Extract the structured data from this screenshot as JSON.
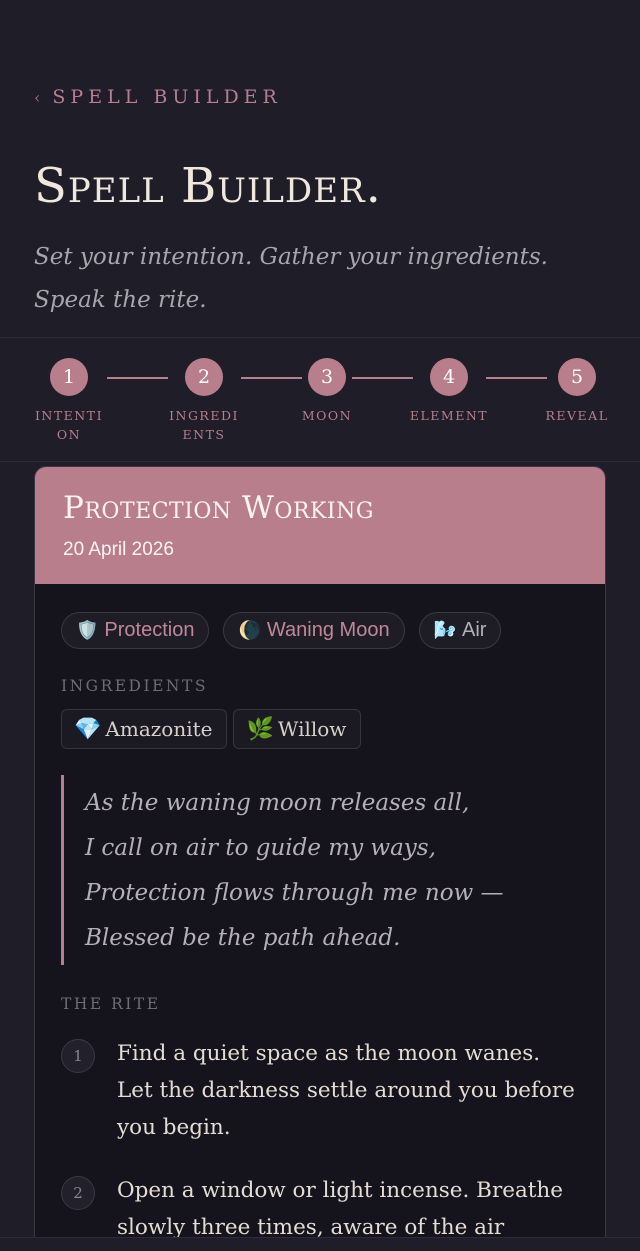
{
  "header": {
    "back_label": "SPELL BUILDER",
    "title": "Spell Builder.",
    "subtitle": "Set your intention. Gather your ingredients. Speak the rite."
  },
  "stepper": {
    "steps": [
      {
        "num": "1",
        "label": "INTENTI ON"
      },
      {
        "num": "2",
        "label": "INGREDI ENTS"
      },
      {
        "num": "3",
        "label": "MOON"
      },
      {
        "num": "4",
        "label": "ELEMENT"
      },
      {
        "num": "5",
        "label": "REVEAL"
      }
    ]
  },
  "card": {
    "title": "Protection Working",
    "date": "20 April 2026",
    "tags": [
      {
        "icon": "🛡️",
        "icon_name": "shield-icon",
        "label": "Protection"
      },
      {
        "icon": "🌘",
        "icon_name": "waning-moon-icon",
        "label": "Waning Moon"
      },
      {
        "icon": "🌬️",
        "icon_name": "wind-icon",
        "label": "Air"
      }
    ],
    "ingredients_label": "INGREDIENTS",
    "ingredients": [
      {
        "icon": "💎",
        "icon_name": "gem-icon",
        "label": "Amazonite"
      },
      {
        "icon": "🌿",
        "icon_name": "herb-icon",
        "label": "Willow"
      }
    ],
    "verse": [
      "As the waning moon releases all,",
      "I call on air to guide my ways,",
      "Protection flows through me now —",
      "Blessed be the path ahead."
    ],
    "rite_label": "THE RITE",
    "rite": [
      {
        "num": "1",
        "text": "Find a quiet space as the moon wanes. Let the darkness settle around you before you begin."
      },
      {
        "num": "2",
        "text": "Open a window or light incense. Breathe slowly three times, aware of the air"
      }
    ]
  },
  "colors": {
    "accent": "#b87e8c",
    "background": "#1e1d28",
    "card": "#15141c"
  }
}
